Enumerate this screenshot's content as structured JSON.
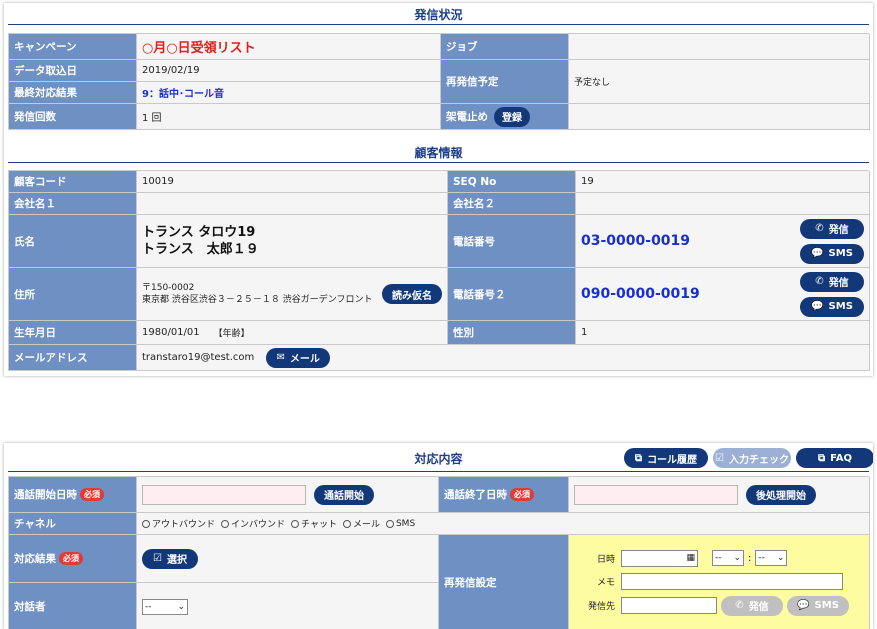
{
  "hasshin": {
    "title": "発信状況",
    "campaign_label": "キャンペーン",
    "campaign_value": "○月○日受領リスト",
    "job_label": "ジョブ",
    "import_date_label": "データ取込日",
    "import_date_value": "2019/02/19",
    "last_result_label": "最終対応結果",
    "last_result_value": "9：話中･コール音",
    "recall_label": "再発信予定",
    "recall_value": "予定なし",
    "call_count_label": "発信回数",
    "call_count_value": "1 回",
    "stop_label": "架電止め",
    "register_button": "登録"
  },
  "customer": {
    "title": "顧客情報",
    "code_label": "顧客コード",
    "code_value": "10019",
    "seq_label": "SEQ No",
    "seq_value": "19",
    "company1_label": "会社名１",
    "company2_label": "会社名２",
    "name_label": "氏名",
    "name_kana": "トランス タロウ19",
    "name_kanji": "トランス　太郎１９",
    "tel_label": "電話番号",
    "tel_value": "03-0000-0019",
    "address_label": "住所",
    "zip": "〒150-0002",
    "address": "東京都 渋谷区渋谷３－２５－１８ 渋谷ガーデンフロント",
    "yomi_button": "読み仮名",
    "tel2_label": "電話番号２",
    "tel2_value": "090-0000-0019",
    "birth_label": "生年月日",
    "birth_value": "1980/01/01",
    "age_value": "【年齢】",
    "gender_label": "性別",
    "gender_value": "1",
    "mail_label": "メールアドレス",
    "mail_value": "transtaro19@test.com",
    "mail_button": "メール",
    "call_button": "発信",
    "sms_button": "SMS"
  },
  "response": {
    "title": "対応内容",
    "history_button": "コール履歴",
    "check_button": "入力チェック",
    "faq_button": "FAQ",
    "start_label": "通話開始日時",
    "required": "必須",
    "start_button": "通話開始",
    "end_label": "通話終了日時",
    "end_button": "後処理開始",
    "channel_label": "チャネル",
    "channels": [
      "アウトバウンド",
      "インバウンド",
      "チャット",
      "メール",
      "SMS"
    ],
    "result_label": "対応結果",
    "select_button": "選択",
    "recall_label": "再発信設定",
    "datetime_label": "日時",
    "memo_label": "メモ",
    "dest_label": "発信先",
    "time_sep": ":",
    "dash": "--",
    "person_label": "対話者",
    "person_value": "--",
    "call_button": "発信",
    "sms_button": "SMS"
  }
}
